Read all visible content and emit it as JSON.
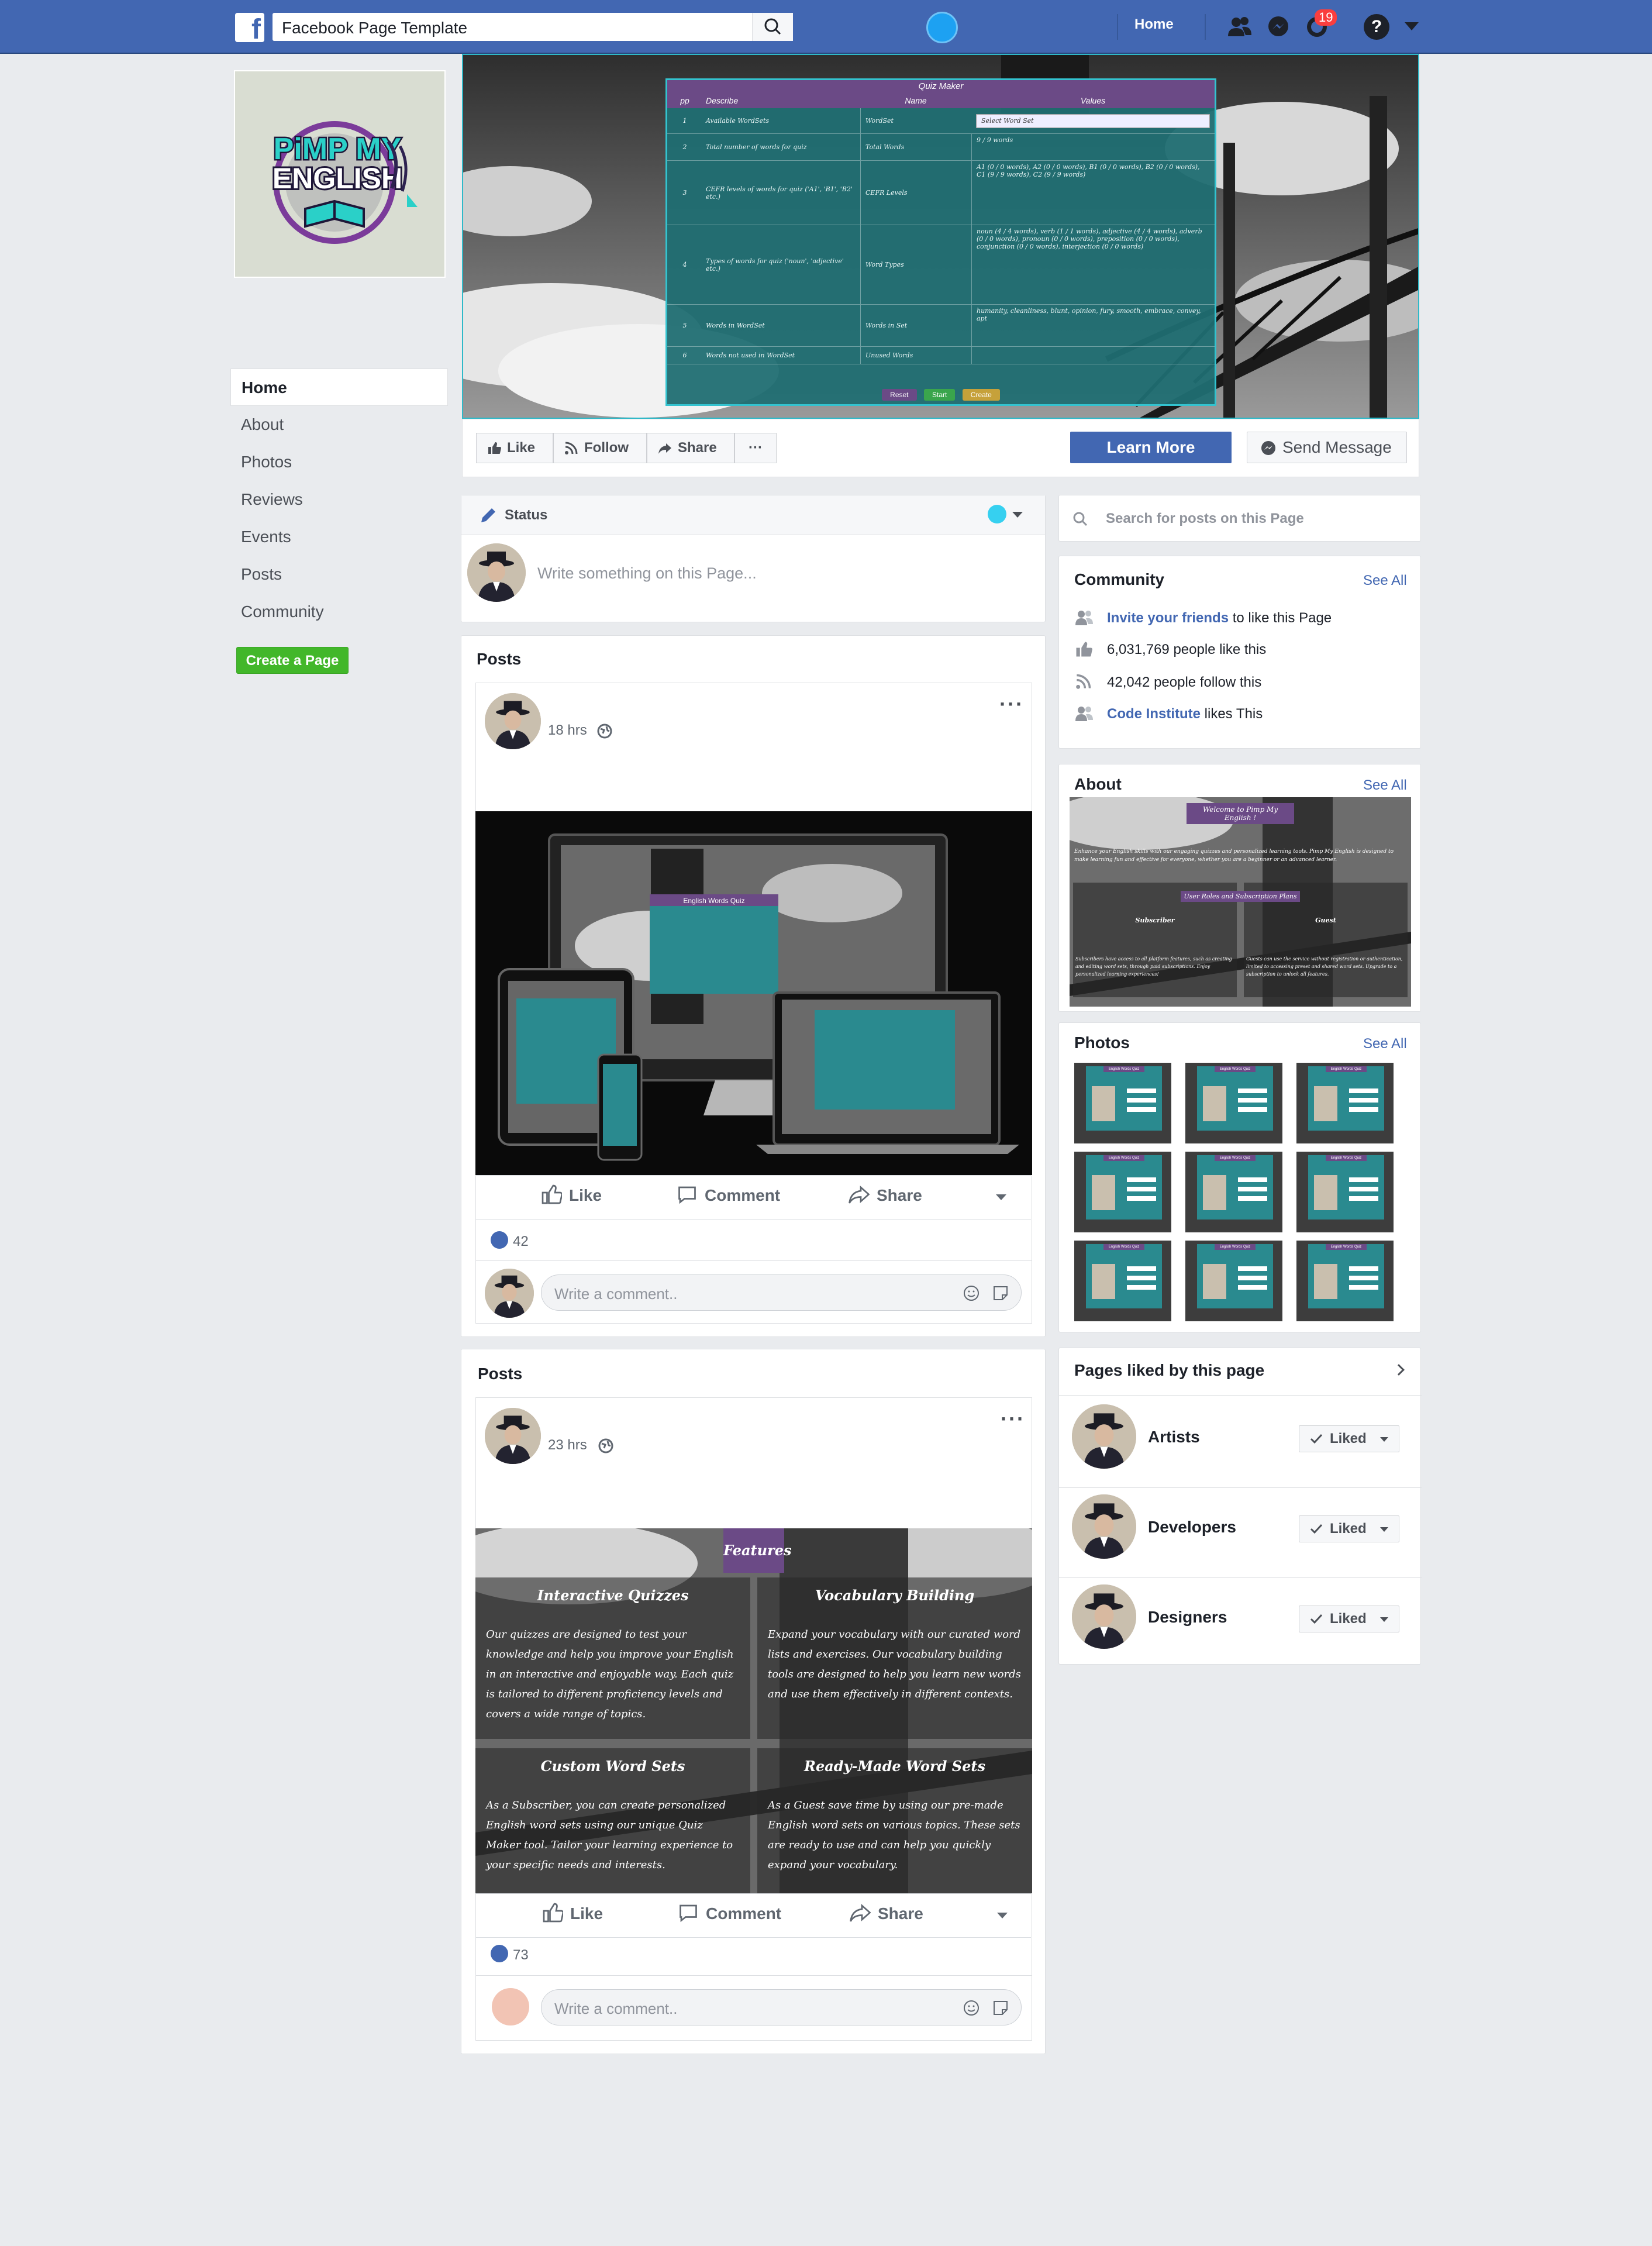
{
  "topbar": {
    "search_value": "Facebook Page Template",
    "home_label": "Home",
    "notifications_count": "19"
  },
  "profile": {
    "logo_line1": "PiMP MY",
    "logo_line2": "ENGLISH"
  },
  "left_nav": {
    "items": [
      "Home",
      "About",
      "Photos",
      "Reviews",
      "Events",
      "Posts",
      "Community"
    ],
    "create_page_label": "Create a Page"
  },
  "cover": {
    "quiz_title": "Quiz Maker",
    "headers": [
      "pp",
      "Describe",
      "Name",
      "Values"
    ],
    "rows": [
      {
        "n": "1",
        "desc": "Available WordSets",
        "name": "WordSet",
        "value": "Select Word Set"
      },
      {
        "n": "2",
        "desc": "Total number of words for quiz",
        "name": "Total Words",
        "value": "9 / 9 words"
      },
      {
        "n": "3",
        "desc": "CEFR levels of words for quiz ('A1', 'B1', 'B2' etc.)",
        "name": "CEFR Levels",
        "value": "A1 (0 / 0 words), A2 (0 / 0 words), B1 (0 / 0 words), B2 (0 / 0 words), C1 (9 / 9 words), C2 (9 / 9 words)"
      },
      {
        "n": "4",
        "desc": "Types of words for quiz ('noun', 'adjective' etc.)",
        "name": "Word Types",
        "value": "noun (4 / 4 words), verb (1 / 1 words), adjective (4 / 4 words), adverb (0 / 0 words), pronoun (0 / 0 words), preposition (0 / 0 words), conjunction (0 / 0 words), interjection (0 / 0 words)"
      },
      {
        "n": "5",
        "desc": "Words in WordSet",
        "name": "Words in Set",
        "value": "humanity, cleanliness, blunt, opinion, fury, smooth, embrace, convey, apt"
      },
      {
        "n": "6",
        "desc": "Words not used in WordSet",
        "name": "Unused Words",
        "value": ""
      }
    ],
    "buttons": [
      "Reset",
      "Start",
      "Create"
    ]
  },
  "action_bar": {
    "like": "Like",
    "follow": "Follow",
    "share": "Share",
    "more": "···",
    "learn_more": "Learn More",
    "send_message": "Send Message"
  },
  "composer": {
    "status_label": "Status",
    "placeholder": "Write something on this Page..."
  },
  "posts": [
    {
      "heading": "Posts",
      "time": "18 hrs",
      "image_caption": "English Words Quiz",
      "like": "Like",
      "comment": "Comment",
      "share": "Share",
      "likes": "42",
      "comment_placeholder": "Write a comment.."
    },
    {
      "heading": "Posts",
      "time": "23 hrs",
      "features_title": "Features",
      "features": [
        {
          "title": "Interactive Quizzes",
          "text": "Our quizzes are designed to test your knowledge and help you improve your English in an interactive and enjoyable way. Each quiz is tailored to different proficiency levels and covers a wide range of topics."
        },
        {
          "title": "Vocabulary Building",
          "text": "Expand your vocabulary with our curated word lists and exercises. Our vocabulary building tools are designed to help you learn new words and use them effectively in different contexts."
        },
        {
          "title": "Custom Word Sets",
          "text": "As a Subscriber, you can create personalized English word sets using our unique Quiz Maker tool. Tailor your learning experience to your specific needs and interests."
        },
        {
          "title": "Ready-Made Word Sets",
          "text": "As a Guest save time by using our pre-made English word sets on various topics. These sets are ready to use and can help you quickly expand your vocabulary."
        }
      ],
      "like": "Like",
      "comment": "Comment",
      "share": "Share",
      "likes": "73",
      "comment_placeholder": "Write a comment.."
    }
  ],
  "right": {
    "search_placeholder": "Search for posts on this Page",
    "community": {
      "title": "Community",
      "see_all": "See All",
      "invite_link": "Invite your friends",
      "invite_rest": " to like this Page",
      "likes_text": "6,031,769 people like this",
      "follow_text": "42,042 people follow this",
      "ci_link": "Code Institute",
      "ci_rest": " likes This"
    },
    "about": {
      "title": "About",
      "see_all": "See All",
      "welcome": "Welcome to Pimp My English !",
      "intro": "Enhance your English skills with our engaging quizzes and personalized learning tools. Pimp My English is designed to make learning fun and effective for everyone, whether you are a beginner or an advanced learner.",
      "roles_title": "User Roles and Subscription Plans",
      "subscriber": "Subscriber",
      "guest": "Guest",
      "subscriber_text": "Subscribers have access to all platform features, such as creating and editing word sets, through paid subscriptions. Enjoy personalized learning experiences!",
      "guest_text": "Guests can use the service without registration or authentication, limited to accessing preset and shared word sets. Upgrade to a subscription to unlock all features."
    },
    "photos": {
      "title": "Photos",
      "see_all": "See All",
      "count": 9,
      "thumb_title": "English Words Quiz"
    },
    "pages_liked": {
      "title": "Pages liked by this page",
      "pages": [
        {
          "name": "Artists",
          "button": "Liked"
        },
        {
          "name": "Developers",
          "button": "Liked"
        },
        {
          "name": "Designers",
          "button": "Liked"
        }
      ]
    }
  },
  "colors": {
    "fb_blue": "#4267b2",
    "green": "#42b72a",
    "teal": "#2a8a8f",
    "purple": "#6b4a86"
  }
}
